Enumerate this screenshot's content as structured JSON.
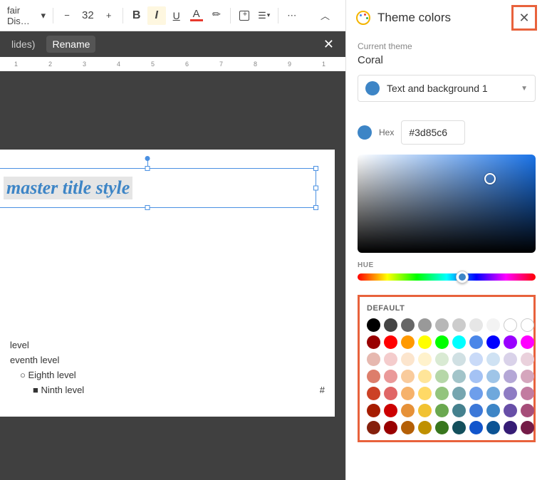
{
  "toolbar": {
    "font_name": "fair Dis…",
    "font_size": "32",
    "bold": "B",
    "italic": "I",
    "underline": "U",
    "text_color_glyph": "A",
    "minus": "−",
    "plus": "+",
    "more": "⋯"
  },
  "tabs": {
    "first": "lides)",
    "second": "Rename"
  },
  "ruler": [
    "1",
    "2",
    "3",
    "4",
    "5",
    "6",
    "7",
    "8",
    "9",
    "1"
  ],
  "slide": {
    "title_text": "master title style",
    "page_placeholder": "#",
    "levels": [
      "level",
      "eventh level",
      "Eighth level",
      "Ninth level"
    ],
    "bullets": [
      "○",
      "■"
    ]
  },
  "sidebar": {
    "title": "Theme colors",
    "current_label": "Current theme",
    "current_theme": "Coral",
    "dropdown_label": "Text and background 1",
    "hex_label": "Hex",
    "hex_value": "#3d85c6",
    "hue_label": "HUE",
    "default_label": "DEFAULT"
  },
  "swatches": [
    [
      "#000000",
      "#444444",
      "#666666",
      "#999999",
      "#b7b7b7",
      "#cccccc",
      "#e6e6e6",
      "#f3f3f3",
      "hollow",
      "hollow"
    ],
    [
      "#990000",
      "#ff0000",
      "#ff9900",
      "#ffff00",
      "#00ff00",
      "#00ffff",
      "#4a86e8",
      "#0000ff",
      "#9900ff",
      "#ff00ff"
    ],
    [
      "#e6b8af",
      "#f4cccc",
      "#fce5cd",
      "#fff2cc",
      "#d9ead3",
      "#d0e0e3",
      "#c9daf8",
      "#cfe2f3",
      "#d9d2e9",
      "#ead1dc"
    ],
    [
      "#dd7e6b",
      "#ea9999",
      "#f9cb9c",
      "#ffe599",
      "#b6d7a8",
      "#a2c4c9",
      "#a4c2f4",
      "#9fc5e8",
      "#b4a7d6",
      "#d5a6bd"
    ],
    [
      "#cc4125",
      "#e06666",
      "#f6b26b",
      "#ffd966",
      "#93c47d",
      "#76a5af",
      "#6d9eeb",
      "#6fa8dc",
      "#8e7cc3",
      "#c27ba0"
    ],
    [
      "#a61c00",
      "#cc0000",
      "#e69138",
      "#f1c232",
      "#6aa84f",
      "#45818e",
      "#3c78d8",
      "#3d85c6",
      "#674ea7",
      "#a64d79"
    ],
    [
      "#85200c",
      "#990000",
      "#b45f06",
      "#bf9000",
      "#38761d",
      "#134f5c",
      "#1155cc",
      "#0b5394",
      "#351c75",
      "#741b47"
    ]
  ]
}
